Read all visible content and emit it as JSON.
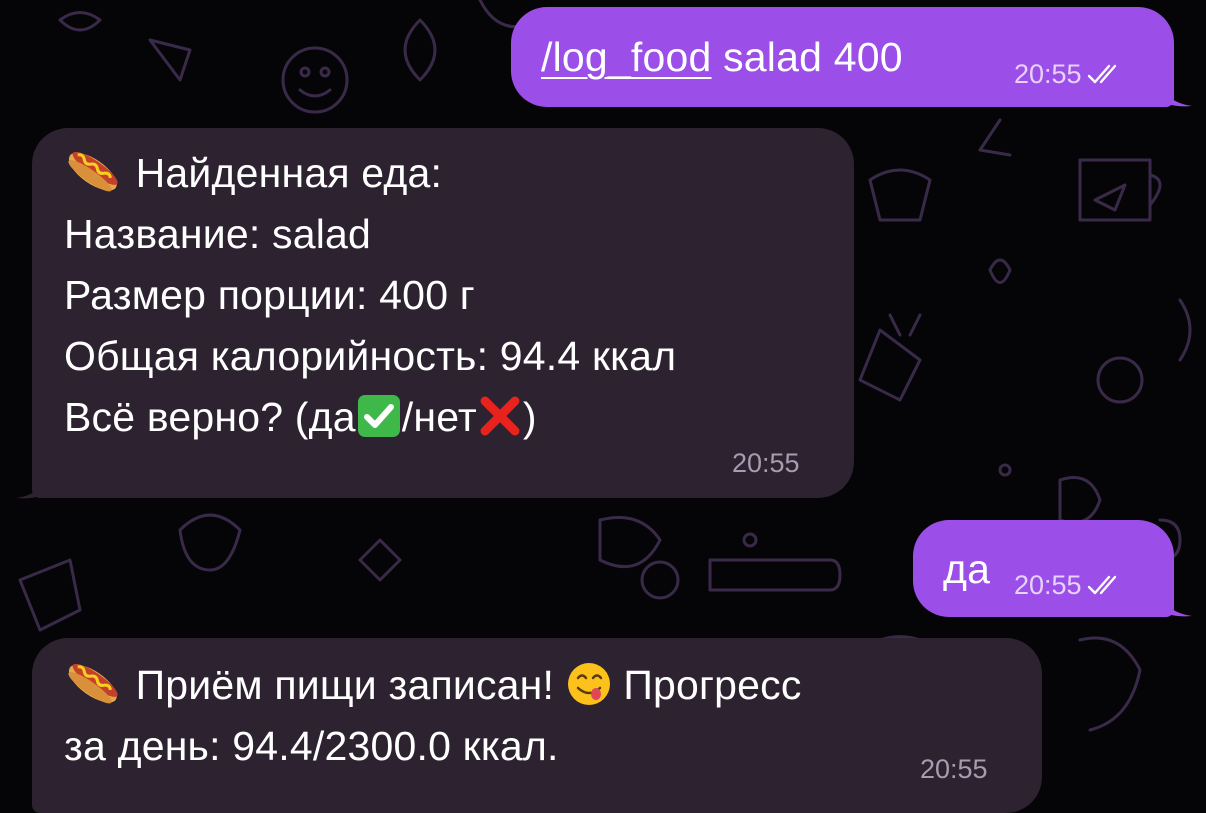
{
  "chat": {
    "messages": [
      {
        "direction": "outgoing",
        "command": "/log_food",
        "text": " salad 400",
        "time": "20:55",
        "status_icon": "double-check-icon"
      },
      {
        "direction": "incoming",
        "lines": {
          "found": "Найденная еда:",
          "name": "Название: salad",
          "portion": "Размер порции: 400 г",
          "calories": "Общая калорийность: 94.4 ккал",
          "confirm_prefix": "Всё верно? (да",
          "confirm_middle": "/нет",
          "confirm_suffix": ")"
        },
        "icons": [
          "hot-dog-icon",
          "check-mark-icon",
          "cross-mark-icon"
        ],
        "time": "20:55"
      },
      {
        "direction": "outgoing",
        "text": "да",
        "time": "20:55",
        "status_icon": "double-check-icon"
      },
      {
        "direction": "incoming",
        "lines": {
          "logged": "Приём пищи записан!",
          "progress_word": "Прогресс",
          "progress_line": "за день: 94.4/2300.0 ккал."
        },
        "icons": [
          "hot-dog-icon",
          "yum-face-icon"
        ],
        "time": "20:55"
      }
    ]
  },
  "colors": {
    "background": "#050406",
    "outgoing_bubble": "#9b4fe8",
    "incoming_bubble": "#2c2230",
    "wallpaper_doodle": "#3a2a4a"
  }
}
